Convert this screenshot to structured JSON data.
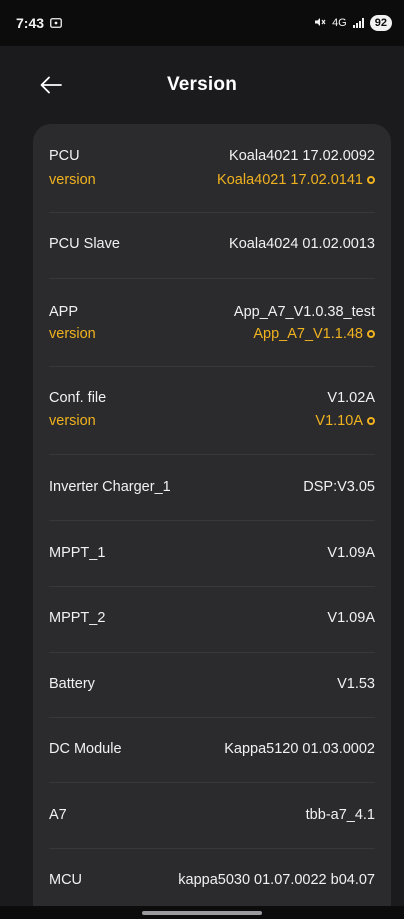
{
  "status_bar": {
    "time": "7:43",
    "network": "4G",
    "battery": "92"
  },
  "header": {
    "title": "Version"
  },
  "rows": [
    {
      "label": "PCU",
      "value": "Koala4021 17.02.0092",
      "sub_label": "version",
      "sub_value": "Koala4021 17.02.0141"
    },
    {
      "label": "PCU Slave",
      "value": "Koala4024 01.02.0013"
    },
    {
      "label": "APP",
      "value": "App_A7_V1.0.38_test",
      "sub_label": "version",
      "sub_value": "App_A7_V1.1.48"
    },
    {
      "label": "Conf. file",
      "value": "V1.02A",
      "sub_label": "version",
      "sub_value": "V1.10A"
    },
    {
      "label": "Inverter Charger_1",
      "value": "DSP:V3.05"
    },
    {
      "label": "MPPT_1",
      "value": "V1.09A"
    },
    {
      "label": "MPPT_2",
      "value": "V1.09A"
    },
    {
      "label": "Battery",
      "value": "V1.53"
    },
    {
      "label": "DC Module",
      "value": "Kappa5120 01.03.0002"
    },
    {
      "label": "A7",
      "value": "tbb-a7_4.1"
    },
    {
      "label": "MCU",
      "value": "kappa5030 01.07.0022 b04.07"
    }
  ],
  "colors": {
    "background": "#1b1b1d",
    "card": "#2b2b2e",
    "accent": "#f0b21e",
    "text": "#ffffff"
  }
}
